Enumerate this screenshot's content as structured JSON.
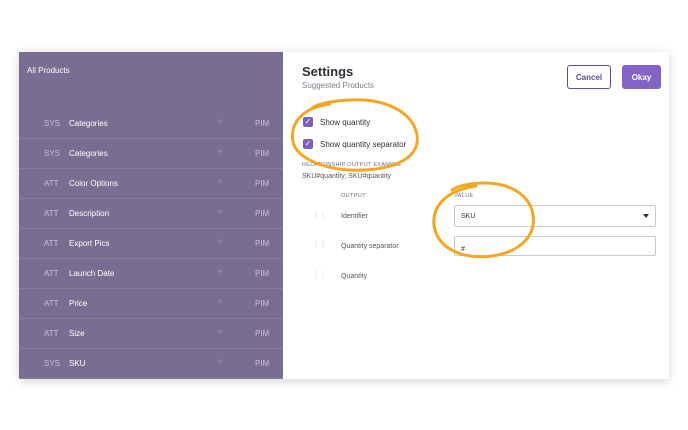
{
  "left_panel": {
    "header": "All Products",
    "rows": [
      {
        "type": "SYS",
        "name": "Categories",
        "source": "PIM"
      },
      {
        "type": "SYS",
        "name": "Categories",
        "source": "PIM"
      },
      {
        "type": "ATT",
        "name": "Color Options",
        "source": "PIM"
      },
      {
        "type": "ATT",
        "name": "Description",
        "source": "PIM"
      },
      {
        "type": "ATT",
        "name": "Export Pics",
        "source": "PIM"
      },
      {
        "type": "ATT",
        "name": "Launch Date",
        "source": "PIM"
      },
      {
        "type": "ATT",
        "name": "Price",
        "source": "PIM"
      },
      {
        "type": "ATT",
        "name": "Size",
        "source": "PIM"
      },
      {
        "type": "SYS",
        "name": "SKU",
        "source": "PIM"
      }
    ]
  },
  "settings": {
    "title": "Settings",
    "subtitle": "Suggested Products",
    "cancel_label": "Cancel",
    "okay_label": "Okay",
    "show_quantity_label": "Show quantity",
    "show_quantity_checked": true,
    "show_separator_label": "Show quantity separator",
    "show_separator_checked": true,
    "example_label": "RELATIONSHIP OUTPUT EXAMPLE",
    "example_value": "SKU#quantity, SKU#quantity",
    "col_output": "OUTPUT",
    "col_value": "VALUE",
    "outputs": [
      {
        "label": "Identifier",
        "value": "SKU"
      },
      {
        "label": "Quantity separator",
        "value": "#"
      },
      {
        "label": "Quantity",
        "value": ""
      }
    ]
  },
  "colors": {
    "accent": "#8563c6",
    "annotation": "#f5a623",
    "overlay": "#7a6d92"
  }
}
